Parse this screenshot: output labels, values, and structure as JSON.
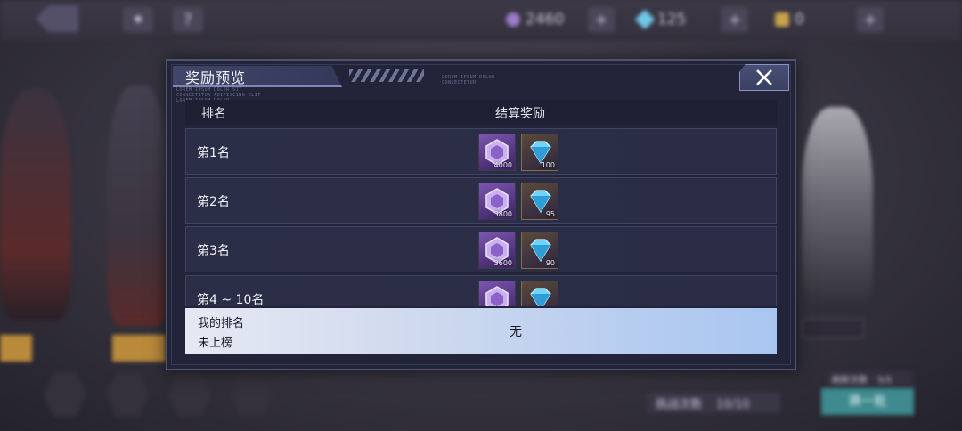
{
  "top": {
    "currencies": [
      {
        "name": "purple-gem",
        "value": "2460",
        "color": "#9a7cc8"
      },
      {
        "name": "blue-diamond",
        "value": "125",
        "color": "#6fc8e8"
      },
      {
        "name": "gold-ticket",
        "value": "0",
        "color": "#c9a24a"
      }
    ],
    "help_icon": "?",
    "plus_label": "+"
  },
  "background": {
    "refresh_button": "换一批",
    "challenge_label": "挑战次数",
    "challenge_value": "10/10",
    "chance_label": "刷新次数",
    "chance_value": "5/5"
  },
  "modal": {
    "title": "奖励预览",
    "deco_text_1": "LOREM IPSUM DOLOR SIT\nCONSECTETUR ADIPISCING ELIT\nLOREM IPSUM DOLOR",
    "deco_text_2": "LOREM IPSUM DOLOR\nCONSECTETUR",
    "columns": {
      "rank": "排名",
      "reward": "结算奖励"
    },
    "rows": [
      {
        "label": "第1名",
        "rewards": [
          {
            "icon": "purple-gem-icon",
            "count": "4000"
          },
          {
            "icon": "blue-diamond-icon",
            "count": "100"
          }
        ]
      },
      {
        "label": "第2名",
        "rewards": [
          {
            "icon": "purple-gem-icon",
            "count": "3800"
          },
          {
            "icon": "blue-diamond-icon",
            "count": "95"
          }
        ]
      },
      {
        "label": "第3名",
        "rewards": [
          {
            "icon": "purple-gem-icon",
            "count": "3600"
          },
          {
            "icon": "blue-diamond-icon",
            "count": "90"
          }
        ]
      },
      {
        "label": "第4 ~ 10名",
        "rewards": [
          {
            "icon": "purple-gem-icon",
            "count": ""
          },
          {
            "icon": "blue-diamond-icon",
            "count": ""
          }
        ]
      }
    ],
    "my_rank": {
      "title": "我的排名",
      "status": "未上榜",
      "reward": "无"
    }
  }
}
